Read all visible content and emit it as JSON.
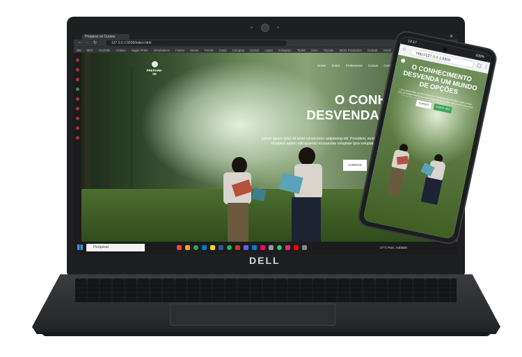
{
  "browser": {
    "tab_title": "Preparar os Cursos",
    "url": "127.0.0.1:5500/index.html",
    "bookmarks": [
      "MD",
      "MCF",
      "YouTube",
      "Arduino",
      "Vagas Prime",
      "Simuladores",
      "Fontes",
      "Steam",
      "Torrent",
      "Camp",
      "Compras",
      "Cursos",
      "Logos",
      "Instagram",
      "Toolkit",
      "Sites",
      "Youtube",
      "Music Production",
      "Outlook",
      "Gmail",
      "Modelo"
    ]
  },
  "site": {
    "logo_text": "PREPARE-SE",
    "nav": [
      "Home",
      "Sobre",
      "Professores",
      "Cursos",
      "Contato"
    ],
    "headline_lines": [
      "O CONHECIMENTO",
      "DESVENDA UM MUNDO",
      "DE OPÇÕES"
    ],
    "lead": "Lorem ipsum dolor sit amet consectetur adipisicing elit. Provident, modi cumque, iusto ad impedit voluptatibus eaque sequi excepturi autem odit quaerat recusandae voluptate ipsa voluptate natus ab laboriosam? Porro, recusandae sapiente!",
    "button_courses": "CURSOS",
    "button_about": "SOBRE NÓS"
  },
  "taskbar": {
    "search_placeholder": "Pesquisar",
    "tray_text": "27°C  Parc. nublado"
  },
  "laptop_brand": "DELL",
  "phone": {
    "time": "14:17",
    "battery": "100%",
    "url": "http://127.0.0.1:5500"
  }
}
